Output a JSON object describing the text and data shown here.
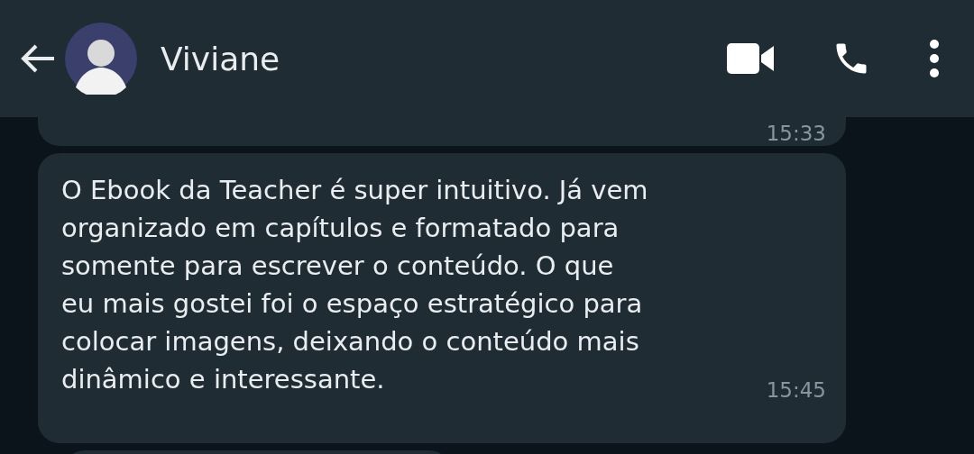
{
  "header": {
    "contact_name": "Viviane"
  },
  "messages": [
    {
      "kind": "partial",
      "time": "15:33"
    },
    {
      "kind": "full",
      "text": "O Ebook da Teacher é super intuitivo. Já vem\norganizado em capítulos e formatado para\nsomente para escrever o conteúdo. O que\neu mais gostei foi o espaço estratégico para\ncolocar imagens, deixando o conteúdo mais\ndinâmico e interessante.",
      "time": "15:45"
    },
    {
      "kind": "peek"
    }
  ]
}
